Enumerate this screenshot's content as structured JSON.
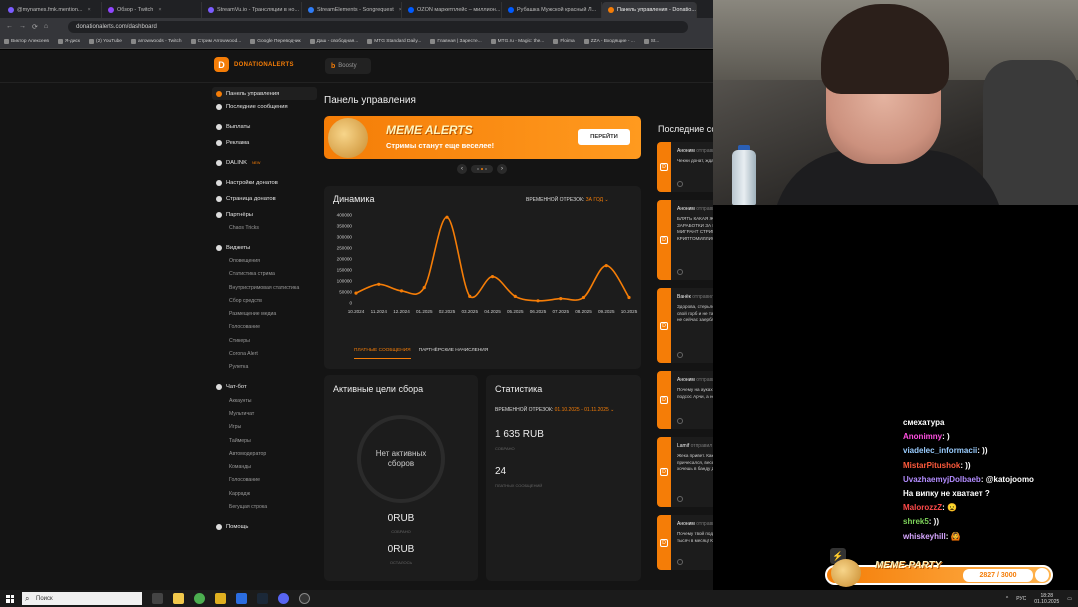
{
  "browser": {
    "tabs": [
      {
        "label": "@mynames.fmk.mention...",
        "color": "#7b5cff"
      },
      {
        "label": "Обзор - Twitch",
        "color": "#9146ff"
      },
      {
        "label": "StreamVu.io - Трансляции в но...",
        "color": "#7b5cff"
      },
      {
        "label": "StreamElements - Songrequest",
        "color": "#2e7cf6"
      },
      {
        "label": "OZON маркетплейс – миллион...",
        "color": "#005bff"
      },
      {
        "label": "Рубашка Мужской красный Л...",
        "color": "#005bff"
      },
      {
        "label": "Панель управления - Donatio...",
        "color": "#f57d07"
      }
    ],
    "url": "donationalerts.com/dashboard",
    "bookmarks": [
      "Виктор Алексеев",
      "Я-диск",
      "(2) YouTube",
      "arrowwoods - Twitch",
      "Стрим Arrowwood...",
      "Google Переводчик",
      "Даш - свободная...",
      "MTG Standard Daily...",
      "Главная | Заресте...",
      "MTG.ru - Magic: the...",
      "Floima",
      "ZZA - Входящие - ...",
      "St..."
    ]
  },
  "header": {
    "logo_text": "DONATIONALERTS",
    "boosty_label": "Boosty"
  },
  "sidebar": {
    "dashboard": "Панель управления",
    "recent_messages": "Последние сообщения",
    "payouts": "Выплаты",
    "ads": "Реклама",
    "dalink": "DALINK",
    "dalink_badge": "NEW",
    "donation_settings": "Настройки донатов",
    "donation_page": "Страница донатов",
    "partners": "Партнёры",
    "partner_sub": "Chaos Tricks",
    "widgets": "Виджеты",
    "widget_items": [
      "Оповещения",
      "Статистика стрима",
      "Внутристримовая статистика",
      "Сбор средств",
      "Размещение медиа",
      "Голосование",
      "Стикеры",
      "Corona Alert",
      "Рулетка"
    ],
    "chatbot": "Чат-бот",
    "chatbot_items": [
      "Аккаунты",
      "Мультичат",
      "Игры",
      "Таймеры",
      "Автомодератор",
      "Команды",
      "Голосование",
      "Каррадж",
      "Бегущая строка"
    ],
    "help": "Помощь"
  },
  "main": {
    "title": "Панель управления",
    "banner": {
      "title": "MEME ALERTS",
      "subtitle": "Стримы станут еще веселее!",
      "button": "ПЕРЕЙТИ"
    },
    "dynamics": {
      "title": "Динамика",
      "period_label": "ВРЕМЕННОЙ ОТРЕЗОК:",
      "period_value": "ЗА ГОД ⌄",
      "tab_paid": "ПЛАТНЫЕ СООБЩЕНИЯ",
      "tab_partner": "ПАРТНЁРСКИЕ НАЧИСЛЕНИЯ"
    },
    "goals": {
      "title": "Активные цели сбора",
      "empty": "Нет активных сборов",
      "collected_amount": "0RUB",
      "collected_label": "СОБРАНО",
      "left_amount": "0RUB",
      "left_label": "ОСТАЛОСЬ"
    },
    "stats": {
      "title": "Статистика",
      "period_label": "ВРЕМЕННОЙ ОТРЕЗОК:",
      "period_value": "01.10.2025 - 01.11.2025 ⌄",
      "amount": "1 635 RUB",
      "amount_label": "СОБРАНО",
      "count": "24",
      "count_label": "ПЛАТНЫХ СООБЩЕНИЙ"
    }
  },
  "recent": {
    "title": "Последние сообщения",
    "messages": [
      {
        "name": "Аноним",
        "sent": "отправил",
        "amount": "",
        "text": "Чекни донат, ждать, пока т",
        "time": ""
      },
      {
        "name": "Аноним",
        "sent": "отправил",
        "amount": "55 RUB",
        "text": "БЛЯТЬ КАКАЯ Ж БЛЯДИНА РАЗГОНЯЕТ ЭТОТ ФОРС ПРО ЗАРАБОТКИ ЗА МЕСЯЦ ДЯДИ ЖЕНИ И ТАДЖА. А НИЧЕ ЧТО ЭТОТ МИГРАНТ СТРИМИТ КАЖДЫЙ ДЕНЬ ПО 12 ЧАСОВ А ДЯДЯ ЖЕНЯ КРИПТОМИЛЛИОНЕР СТРИМИТ 2-3 раза в неделю. ЕБАТ",
        "time": "56 секунд назад"
      },
      {
        "name": "Ванёк",
        "sent": "отправил",
        "amount": "55 RUB",
        "text": "Здорова, стерьлота. Хочу купить массажное кресло, за сколько взял свой горб и не там роликх или каретка? Убил ли на нем катюху?ак да, не сейчас заерблейдованы в нежелзв за пачку помидорое обут.Спасибо",
        "time": "2 минуты назад"
      },
      {
        "name": "Аноним",
        "sent": "отправил",
        "amount": "55 RUB",
        "text": "Почему на ауках Артура донатят больше чем тебе? Может ты уже подсос Арчи, а не наоборот?",
        "time": "3 минуты назад"
      },
      {
        "name": "Lamif",
        "sent": "отправил",
        "amount": "55 RUB",
        "text": "Жека привет. Какие то изменения в тебе, рубашку стиздил из 4б, причесался, веселый такой, рек. Какая твоя цель? Открой секрет свой, хочешь в банду Джаночки? Или копишь на новое кресло. А да я го mug",
        "time": "6 минут назад"
      },
      {
        "name": "Аноним",
        "sent": "отправил",
        "amount": "55 RUB",
        "text": "Почему твой подсос Арчидос зарабатывает в два раза больше тебя 300 тысяч в месяц! Как так получилось?",
        "time": ""
      }
    ]
  },
  "stream_chat": [
    {
      "name": "",
      "text": "смехатура",
      "color": "#ffffff"
    },
    {
      "name": "Anonimny",
      "text": ": )",
      "color": "#ff4fe0"
    },
    {
      "name": "viadelec_informacii",
      "text": ": ))",
      "color": "#9acdff"
    },
    {
      "name": "MistarPitushok",
      "text": ": ))",
      "color": "#ff5a3c"
    },
    {
      "name": "UvazhaemyjDolbaeb",
      "text": ": @katojoomo",
      "color": "#b38cff"
    },
    {
      "name": "",
      "text": "На випку не хватает ?",
      "color": "#ffffff"
    },
    {
      "name": "MalorozzZ",
      "text": ": 😦",
      "color": "#ff4a4a"
    },
    {
      "name": "shrek5",
      "text": ": ))",
      "color": "#7dd35a"
    },
    {
      "name": "whiskeyhill",
      "text": ": 🙆",
      "color": "#d7a6ff"
    }
  ],
  "meme_party": {
    "label": "MEME-PARTY",
    "progress": "2827 / 3000"
  },
  "taskbar": {
    "search_placeholder": "Поиск",
    "lang": "РУС",
    "time": "18:28",
    "date": "01.10.2025"
  },
  "chart_data": {
    "type": "line",
    "categories": [
      "10.2024",
      "11.2024",
      "12.2024",
      "01.2025",
      "02.2025",
      "03.2025",
      "04.2025",
      "05.2025",
      "06.2025",
      "07.2025",
      "08.2025",
      "09.2025",
      "10.2025"
    ],
    "values": [
      45000,
      85000,
      55000,
      70000,
      390000,
      30000,
      120000,
      30000,
      10000,
      20000,
      25000,
      170000,
      25000
    ],
    "ylim": [
      0,
      400000
    ],
    "yticks": [
      0,
      50000,
      100000,
      150000,
      200000,
      250000,
      300000,
      350000,
      400000
    ],
    "grid": false,
    "color": "#f57d07"
  }
}
